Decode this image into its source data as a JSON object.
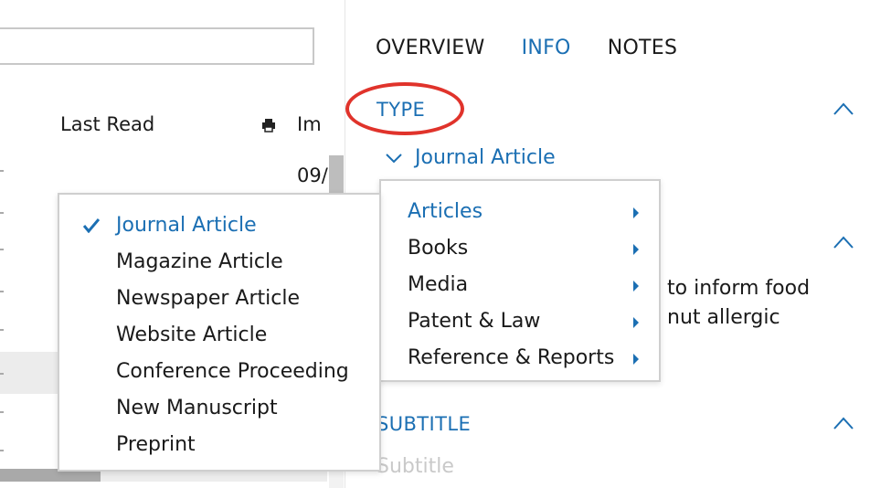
{
  "left_pane": {
    "columns": {
      "last_read": "Last Read",
      "imported_partial": "Im"
    },
    "row_date_partial": "09/"
  },
  "tabs": [
    {
      "label": "OVERVIEW",
      "active": false
    },
    {
      "label": "INFO",
      "active": true
    },
    {
      "label": "NOTES",
      "active": false
    }
  ],
  "sections": {
    "type": {
      "heading": "TYPE",
      "value": "Journal Article"
    },
    "abstract_partial": [
      "to inform food",
      "nut allergic"
    ],
    "subtitle": {
      "heading": "SUBTITLE",
      "placeholder": "Subtitle"
    }
  },
  "category_menu": {
    "items": [
      {
        "label": "Articles",
        "active": true
      },
      {
        "label": "Books",
        "active": false
      },
      {
        "label": "Media",
        "active": false
      },
      {
        "label": "Patent & Law",
        "active": false
      },
      {
        "label": "Reference & Reports",
        "active": false
      }
    ]
  },
  "type_submenu": {
    "items": [
      {
        "label": "Journal Article",
        "checked": true
      },
      {
        "label": "Magazine Article",
        "checked": false
      },
      {
        "label": "Newspaper Article",
        "checked": false
      },
      {
        "label": "Website Article",
        "checked": false
      },
      {
        "label": "Conference Proceeding",
        "checked": false
      },
      {
        "label": "New Manuscript",
        "checked": false
      },
      {
        "label": "Preprint",
        "checked": false
      }
    ]
  },
  "colors": {
    "accent": "#1b6fb3",
    "highlight_circle": "#e0332b",
    "placeholder": "#c9c9c9"
  },
  "icons": [
    "print-icon",
    "chevron-up-icon",
    "chevron-down-icon",
    "check-icon",
    "submenu-arrow-icon"
  ]
}
